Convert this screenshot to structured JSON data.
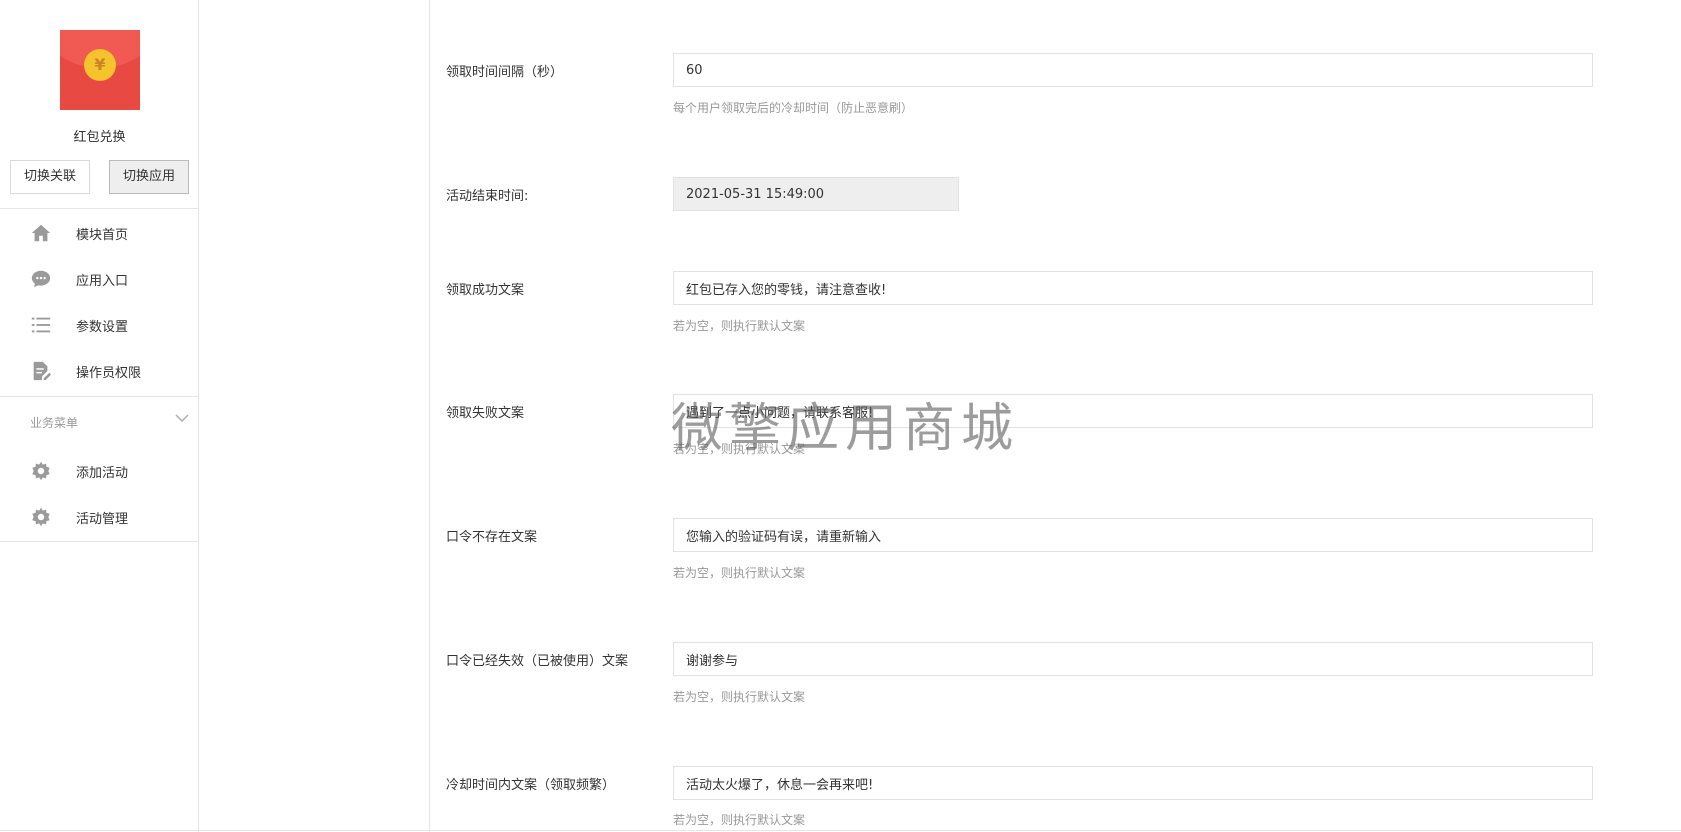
{
  "sidebar": {
    "app_name": "红包兑换",
    "buttons": {
      "switch_link": "切换关联",
      "switch_app": "切换应用"
    },
    "nav": [
      {
        "label": "模块首页",
        "icon": "home-icon"
      },
      {
        "label": "应用入口",
        "icon": "chat-bubble-icon"
      },
      {
        "label": "参数设置",
        "icon": "list-icon"
      },
      {
        "label": "操作员权限",
        "icon": "edit-document-icon"
      }
    ],
    "section_title": "业务菜单",
    "business": [
      {
        "label": "添加活动",
        "icon": "gear-icon"
      },
      {
        "label": "活动管理",
        "icon": "gear-icon"
      }
    ]
  },
  "form": {
    "rows": [
      {
        "label": "领取时间间隔（秒）",
        "value": "60",
        "help": "每个用户领取完后的冷却时间（防止恶意刷）"
      },
      {
        "label": "活动结束时间:",
        "value": "2021-05-31 15:49:00",
        "help": ""
      },
      {
        "label": "领取成功文案",
        "value": "红包已存入您的零钱，请注意查收!",
        "help": "若为空，则执行默认文案"
      },
      {
        "label": "领取失败文案",
        "value": "遇到了一点小问题，请联系客服!",
        "help": "若为空，则执行默认文案"
      },
      {
        "label": "口令不存在文案",
        "value": "您输入的验证码有误，请重新输入",
        "help": "若为空，则执行默认文案"
      },
      {
        "label": "口令已经失效（已被使用）文案",
        "value": "谢谢参与",
        "help": "若为空，则执行默认文案"
      },
      {
        "label": "冷却时间内文案（领取频繁）",
        "value": "活动太火爆了，休息一会再来吧!",
        "help": "若为空，则执行默认文案"
      }
    ]
  },
  "watermark": "微擎应用商城",
  "colors": {
    "logo_red": "#e84a43",
    "coin_gold": "#f5c42c",
    "icon_gray": "#9a9a9a"
  }
}
